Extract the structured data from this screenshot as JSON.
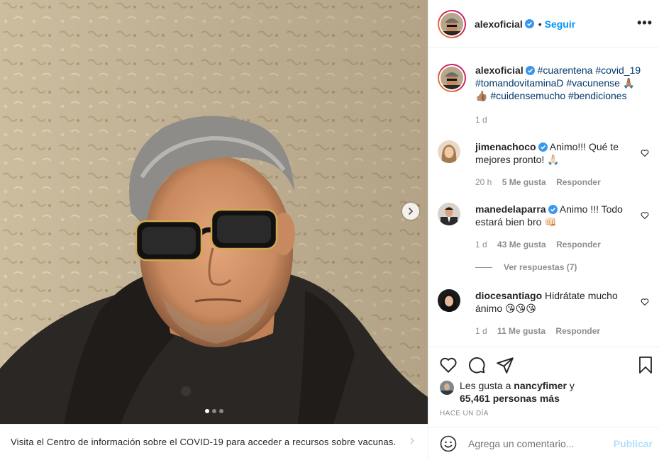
{
  "post": {
    "username": "alexoficial",
    "follow_label": "Seguir",
    "more_label": "•••",
    "separator": "•",
    "carousel_dots": 3,
    "carousel_active": 0
  },
  "banner": {
    "text": "Visita el Centro de información sobre el COVID-19 para acceder a recursos sobre vacunas."
  },
  "caption": {
    "username": "alexoficial",
    "hashtags_line": "#cuarentena #covid_19 #tomandovitaminaD #vacunense 🙏🏽 👍🏽 #cuidensemucho #bendiciones",
    "age": "1 d"
  },
  "comments": [
    {
      "username": "jimenachoco",
      "text": "Animo!!! Qué te mejores pronto! 🙏🏻",
      "age": "20 h",
      "likes": "5 Me gusta",
      "reply": "Responder"
    },
    {
      "username": "manedelaparra",
      "text": "Animo !!! Todo estará bien bro 👊🏻",
      "age": "1 d",
      "likes": "43 Me gusta",
      "reply": "Responder"
    },
    {
      "username": "diocesantiago",
      "text": "Hidrátate mucho ánimo 😘😘😘",
      "age": "1 d",
      "likes": "11 Me gusta",
      "reply": "Responder"
    }
  ],
  "see_replies": "Ver respuestas (7)",
  "likes": {
    "prefix": "Les gusta a",
    "user": "nancyfimer",
    "conj": "y",
    "count": "65,461 personas más"
  },
  "timestamp": "HACE UN DÍA",
  "add_comment": {
    "placeholder": "Agrega un comentario...",
    "post_label": "Publicar"
  },
  "colors": {
    "accent": "#0095f6",
    "verified": "#3897f0",
    "post_disabled": "#b2dffc"
  }
}
